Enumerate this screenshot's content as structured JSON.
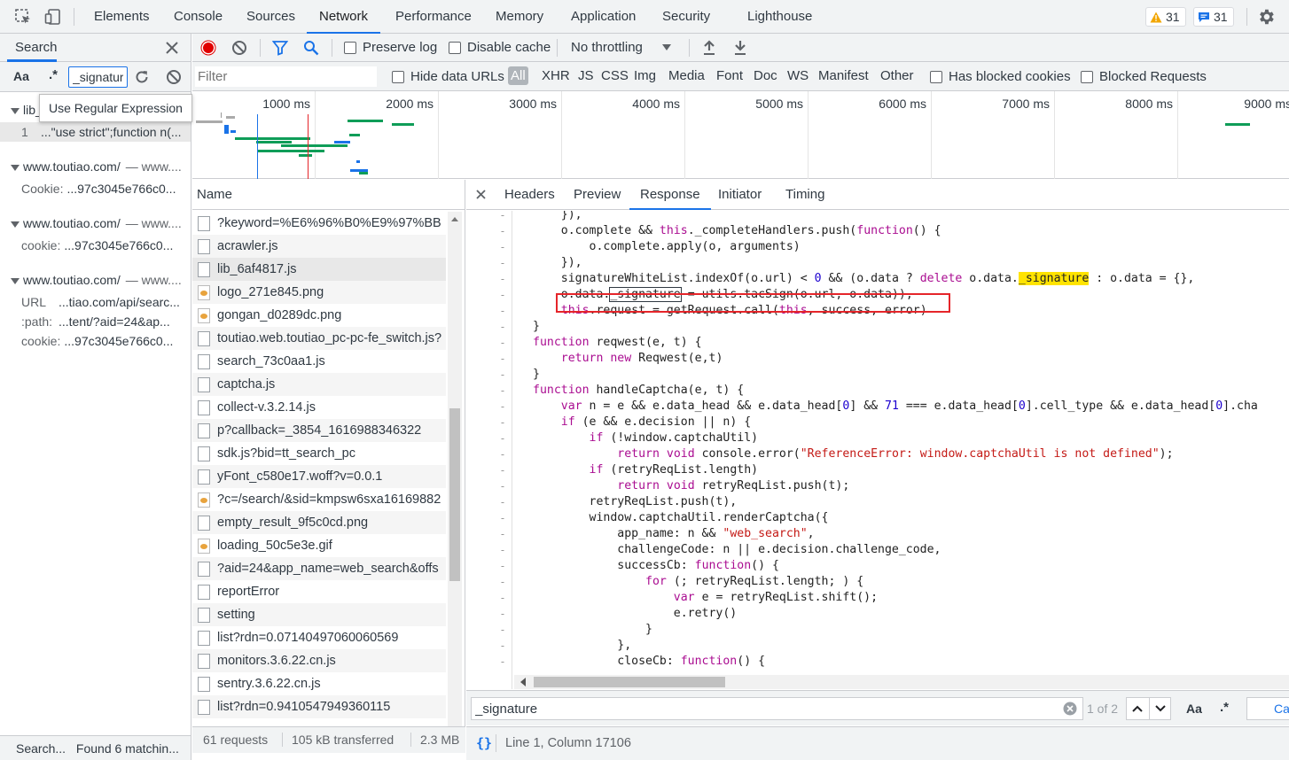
{
  "tabs": {
    "items": [
      "Elements",
      "Console",
      "Sources",
      "Network",
      "Performance",
      "Memory",
      "Application",
      "Security",
      "Lighthouse"
    ],
    "active": "Network"
  },
  "badges": {
    "warnings": "31",
    "messages": "31"
  },
  "search_panel": {
    "title": "Search",
    "case_toggle": "Aa",
    "regex_toggle": ".*",
    "query": "_signatur",
    "tooltip": "Use Regular Expression",
    "results": [
      {
        "file": "lib_",
        "url": "",
        "lines": [
          {
            "key": "1",
            "text": "...\"use strict\";function n(..."
          }
        ]
      },
      {
        "file": "www.toutiao.com/",
        "url": "— www....",
        "lines": [
          {
            "key": "Cookie:",
            "text": "...97c3045e766c0..."
          }
        ]
      },
      {
        "file": "www.toutiao.com/",
        "url": "— www....",
        "lines": [
          {
            "key": "cookie:",
            "text": "...97c3045e766c0..."
          }
        ]
      },
      {
        "file": "www.toutiao.com/",
        "url": "— www....",
        "lines": [
          {
            "key": "URL",
            "text": "...tiao.com/api/searc..."
          },
          {
            "key": ":path:",
            "text": "...tent/?aid=24&ap..."
          },
          {
            "key": "cookie:",
            "text": "...97c3045e766c0..."
          }
        ]
      }
    ],
    "status_left": "Search...",
    "status_right": "Found 6 matchin..."
  },
  "toolbar": {
    "preserve_log": "Preserve log",
    "disable_cache": "Disable cache",
    "throttling": "No throttling"
  },
  "filter_bar": {
    "placeholder": "Filter",
    "hide_data_urls": "Hide data URLs",
    "types": [
      "All",
      "XHR",
      "JS",
      "CSS",
      "Img",
      "Media",
      "Font",
      "Doc",
      "WS",
      "Manifest",
      "Other"
    ],
    "active_type": "All",
    "has_blocked_cookies": "Has blocked cookies",
    "blocked_requests": "Blocked Requests"
  },
  "overview": {
    "time_labels": [
      "1000 ms",
      "2000 ms",
      "3000 ms",
      "4000 ms",
      "5000 ms",
      "6000 ms",
      "7000 ms",
      "8000 ms",
      "9000 ms"
    ]
  },
  "request_list": {
    "column_name": "Name",
    "requests": [
      {
        "name": "?keyword=%E6%96%B0%E9%97%BB",
        "icon": "doc"
      },
      {
        "name": "acrawler.js",
        "icon": "doc"
      },
      {
        "name": "lib_6af4817.js",
        "icon": "doc"
      },
      {
        "name": "logo_271e845.png",
        "icon": "image"
      },
      {
        "name": "gongan_d0289dc.png",
        "icon": "image"
      },
      {
        "name": "toutiao.web.toutiao_pc-pc-fe_switch.js?",
        "icon": "doc"
      },
      {
        "name": "search_73c0aa1.js",
        "icon": "doc"
      },
      {
        "name": "captcha.js",
        "icon": "doc"
      },
      {
        "name": "collect-v.3.2.14.js",
        "icon": "doc"
      },
      {
        "name": "p?callback=_3854_1616988346322",
        "icon": "doc"
      },
      {
        "name": "sdk.js?bid=tt_search_pc",
        "icon": "doc"
      },
      {
        "name": "yFont_c580e17.woff?v=0.0.1",
        "icon": "doc"
      },
      {
        "name": "?c=/search/&sid=kmpsw6sxa16169882",
        "icon": "image"
      },
      {
        "name": "empty_result_9f5c0cd.png",
        "icon": "doc"
      },
      {
        "name": "loading_50c5e3e.gif",
        "icon": "image"
      },
      {
        "name": "?aid=24&app_name=web_search&offs",
        "icon": "doc"
      },
      {
        "name": "reportError",
        "icon": "doc"
      },
      {
        "name": "setting",
        "icon": "doc"
      },
      {
        "name": "list?rdn=0.07140497060060569",
        "icon": "doc"
      },
      {
        "name": "monitors.3.6.22.cn.js",
        "icon": "doc"
      },
      {
        "name": "sentry.3.6.22.cn.js",
        "icon": "doc"
      },
      {
        "name": "list?rdn=0.9410547949360115",
        "icon": "doc"
      }
    ],
    "selected_index": 2
  },
  "summary": {
    "requests": "61 requests",
    "transferred": "105 kB transferred",
    "resources": "2.3 MB"
  },
  "detail": {
    "tabs": [
      "Headers",
      "Preview",
      "Response",
      "Initiator",
      "Timing"
    ],
    "active": "Response",
    "code_lines": [
      "    }),",
      "    o.complete && this._completeHandlers.push(function() {",
      "        o.complete.apply(o, arguments)",
      "    }),",
      "    signatureWhiteList.indexOf(o.url) < 0 && (o.data ? delete o.data._signature : o.data = {},",
      "    o.data._signature = utils.tacSign(o.url, o.data)),",
      "    this.request = getRequest.call(this, success, error)",
      "}",
      "function reqwest(e, t) {",
      "    return new Reqwest(e,t)",
      "}",
      "function handleCaptcha(e, t) {",
      "    var n = e && e.data_head && e.data_head[0] && 71 === e.data_head[0].cell_type && e.data_head[0].cha",
      "    if (e && e.decision || n) {",
      "        if (!window.captchaUtil)",
      "            return void console.error(\"ReferenceError: window.captchaUtil is not defined\");",
      "        if (retryReqList.length)",
      "            return void retryReqList.push(t);",
      "        retryReqList.push(t),",
      "        window.captchaUtil.renderCaptcha({",
      "            app_name: n && \"web_search\",",
      "            challengeCode: n || e.decision.challenge_code,",
      "            successCb: function() {",
      "                for (; retryReqList.length; ) {",
      "                    var e = retryReqList.shift();",
      "                    e.retry()",
      "                }",
      "            },",
      "            closeCb: function() {"
    ],
    "find": {
      "query": "_signature",
      "count": "1 of 2",
      "case_toggle": "Aa",
      "regex_toggle": ".*",
      "cancel": "Ca"
    },
    "position": "Line 1, Column 17106",
    "pretty_print": "{}"
  },
  "colors": {
    "accent": "#1a73e8",
    "record": "#e00000",
    "highlight": "#ffe300",
    "annotation_box": "#e5252a"
  }
}
